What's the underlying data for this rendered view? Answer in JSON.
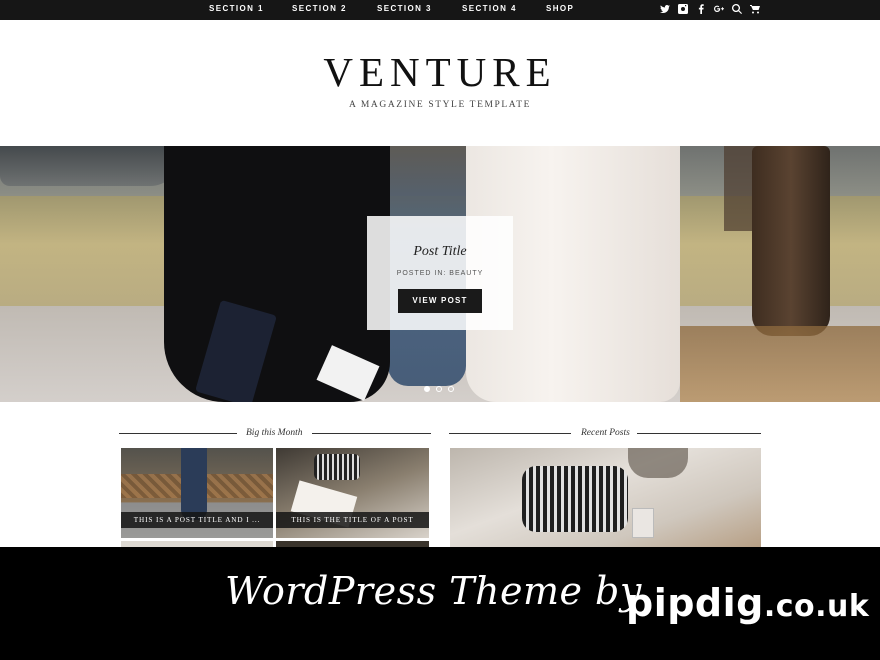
{
  "nav": {
    "items": [
      {
        "label": "Section 1"
      },
      {
        "label": "Section 2"
      },
      {
        "label": "Section 3"
      },
      {
        "label": "Section 4"
      },
      {
        "label": "Shop"
      }
    ],
    "icons": [
      "twitter-icon",
      "instagram-icon",
      "facebook-icon",
      "google-plus-icon",
      "search-icon",
      "cart-icon"
    ]
  },
  "masthead": {
    "title": "VENTURE",
    "tagline": "A MAGAZINE STYLE TEMPLATE"
  },
  "slider": {
    "post_title": "Post Title",
    "category": "Posted in: Beauty",
    "button_label": "View Post",
    "slide_count": 3,
    "active_slide": 1
  },
  "big_this_month": {
    "heading": "Big this Month",
    "posts": [
      {
        "title": "This is a post title and I ..."
      },
      {
        "title": "This is the title of a post"
      }
    ]
  },
  "recent_posts": {
    "heading": "Recent Posts"
  },
  "banner": {
    "text": "WordPress Theme by",
    "brand": "pipdig",
    "tld": ".co.uk"
  }
}
